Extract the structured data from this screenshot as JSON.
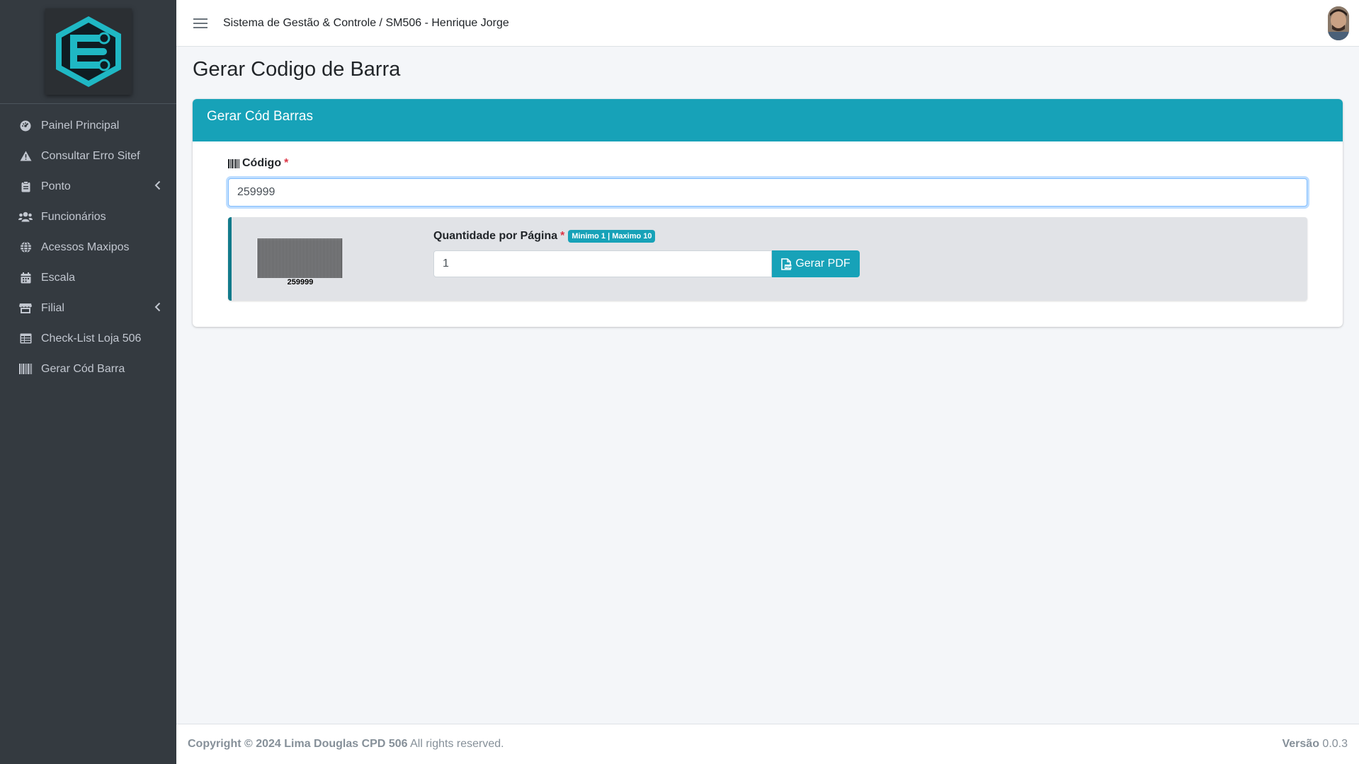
{
  "header": {
    "title": "Sistema de Gestão & Controle / SM506 - Henrique Jorge"
  },
  "sidebar": {
    "items": [
      {
        "label": "Painel Principal",
        "icon": "tachometer-icon"
      },
      {
        "label": "Consultar Erro Sitef",
        "icon": "warning-icon"
      },
      {
        "label": "Ponto",
        "icon": "clipboard-icon",
        "has_submenu": true
      },
      {
        "label": "Funcionários",
        "icon": "users-icon"
      },
      {
        "label": "Acessos Maxipos",
        "icon": "globe-icon"
      },
      {
        "label": "Escala",
        "icon": "calendar-icon"
      },
      {
        "label": "Filial",
        "icon": "store-icon",
        "has_submenu": true
      },
      {
        "label": "Check-List Loja 506",
        "icon": "table-icon"
      },
      {
        "label": "Gerar Cód Barra",
        "icon": "barcode-icon"
      }
    ]
  },
  "page": {
    "title": "Gerar Codigo de Barra"
  },
  "card": {
    "header": "Gerar Cód Barras",
    "codigo_label": "Código",
    "required_mark": "*",
    "codigo_value": "259999",
    "barcode_text": "259999",
    "qty_label": "Quantidade por Página",
    "qty_badge": "Minimo 1 | Maximo 10",
    "qty_value": "1",
    "pdf_button": "Gerar PDF"
  },
  "footer": {
    "copyright": "Copyright © 2024 Lima Douglas CPD 506",
    "rights": " All rights reserved.",
    "version_label": "Versão",
    "version_value": " 0.0.3"
  },
  "colors": {
    "accent": "#17a2b8",
    "sidebar_bg": "#343a40",
    "required": "#dc3545"
  }
}
